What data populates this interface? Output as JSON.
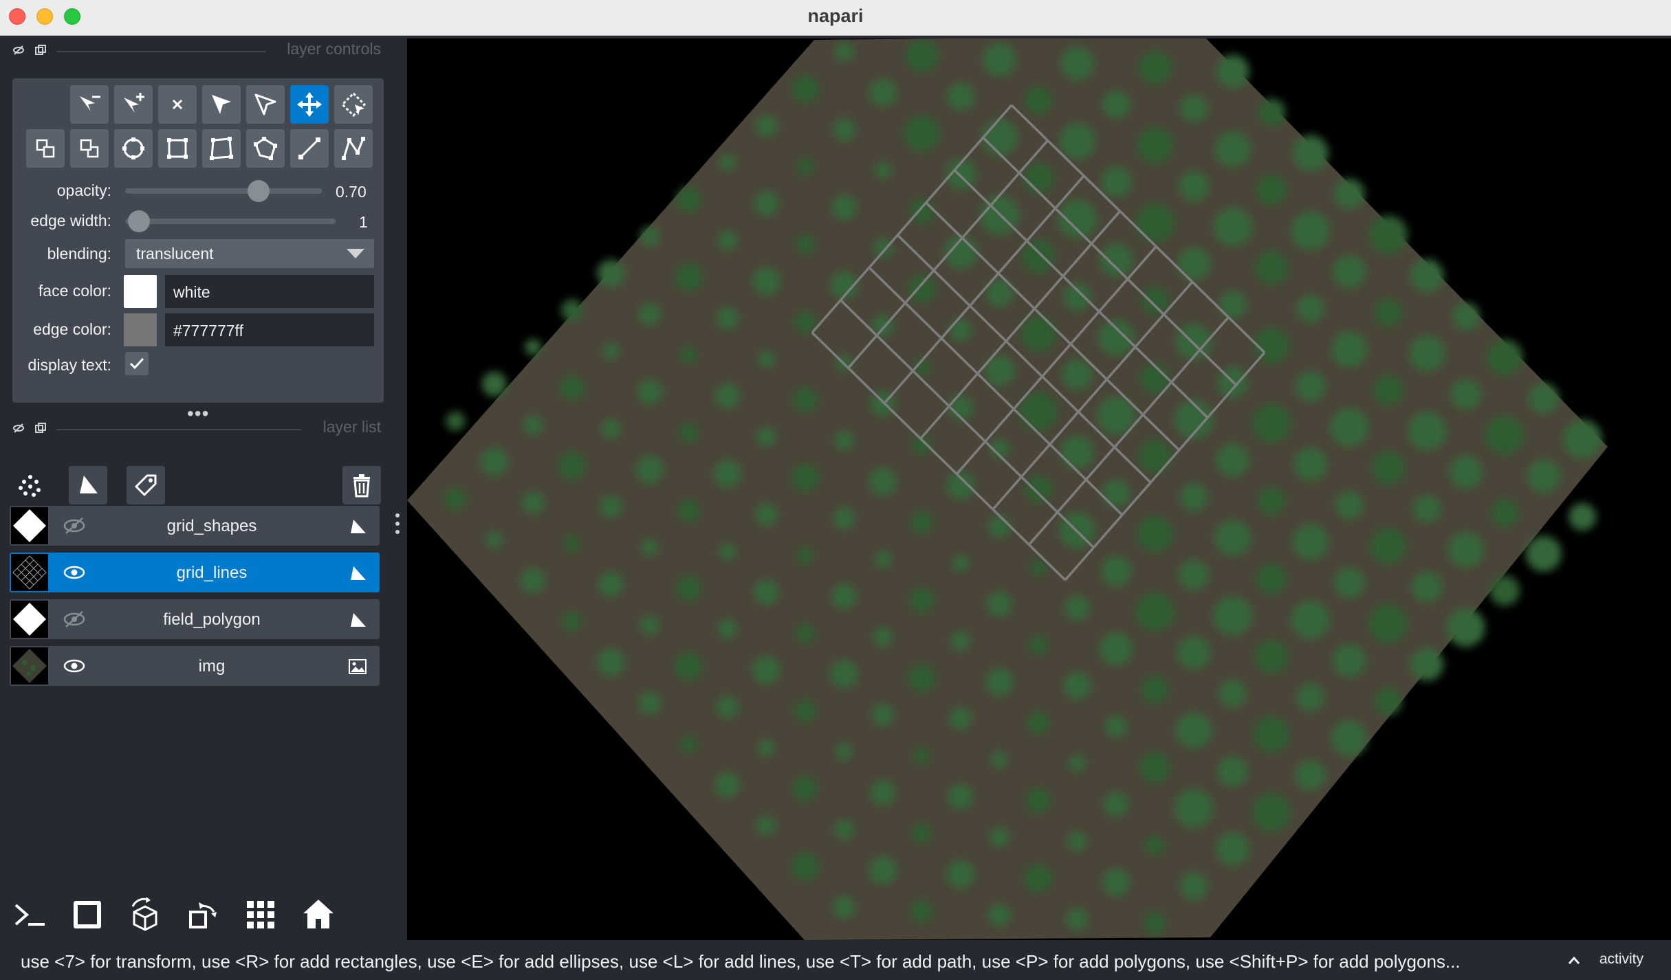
{
  "window": {
    "title": "napari"
  },
  "layer_controls": {
    "header_label": "layer controls",
    "tools_row1": [
      "remove-point-icon",
      "add-point-icon",
      "delete-icon",
      "select-icon",
      "direct-select-icon",
      "transform-icon",
      "lasso-select-icon"
    ],
    "tools_row2": [
      "move-back-icon",
      "move-front-icon",
      "ellipse-icon",
      "rectangle-icon",
      "polygon-icon",
      "polygon-lasso-icon",
      "line-icon",
      "path-icon"
    ],
    "active_tool": "transform-icon",
    "opacity_label": "opacity:",
    "opacity_value": "0.70",
    "opacity_fraction": 0.7,
    "edge_width_label": "edge width:",
    "edge_width_value": "1",
    "blending_label": "blending:",
    "blending_value": "translucent",
    "face_color_label": "face color:",
    "face_color_value": "white",
    "face_color_hex": "#ffffff",
    "edge_color_label": "edge color:",
    "edge_color_value": "#777777ff",
    "edge_color_hex": "#777777",
    "display_text_label": "display text:",
    "display_text_checked": true
  },
  "layer_list": {
    "header_label": "layer list",
    "buttons": [
      "new-points-icon",
      "new-shapes-icon",
      "new-labels-icon",
      "delete-layer-icon"
    ],
    "layers": [
      {
        "name": "grid_shapes",
        "visible": false,
        "type": "shapes",
        "selected": false
      },
      {
        "name": "grid_lines",
        "visible": true,
        "type": "shapes",
        "selected": true
      },
      {
        "name": "field_polygon",
        "visible": false,
        "type": "shapes",
        "selected": false
      },
      {
        "name": "img",
        "visible": true,
        "type": "image",
        "selected": false
      }
    ]
  },
  "viewer_buttons": [
    "console-icon",
    "ndisplay-icon",
    "roll-icon",
    "transpose-icon",
    "grid-icon",
    "home-icon"
  ],
  "status": {
    "message": "use <7> for transform, use <R> for add rectangles, use <E> for add ellipses, use <L> for add lines, use <T> for add path, use <P> for add polygons, use <Shift+P> for add polygons...",
    "activity": "activity"
  },
  "colors": {
    "accent": "#007acc",
    "panel": "#262930",
    "control": "#414851",
    "button": "#5a626c"
  }
}
